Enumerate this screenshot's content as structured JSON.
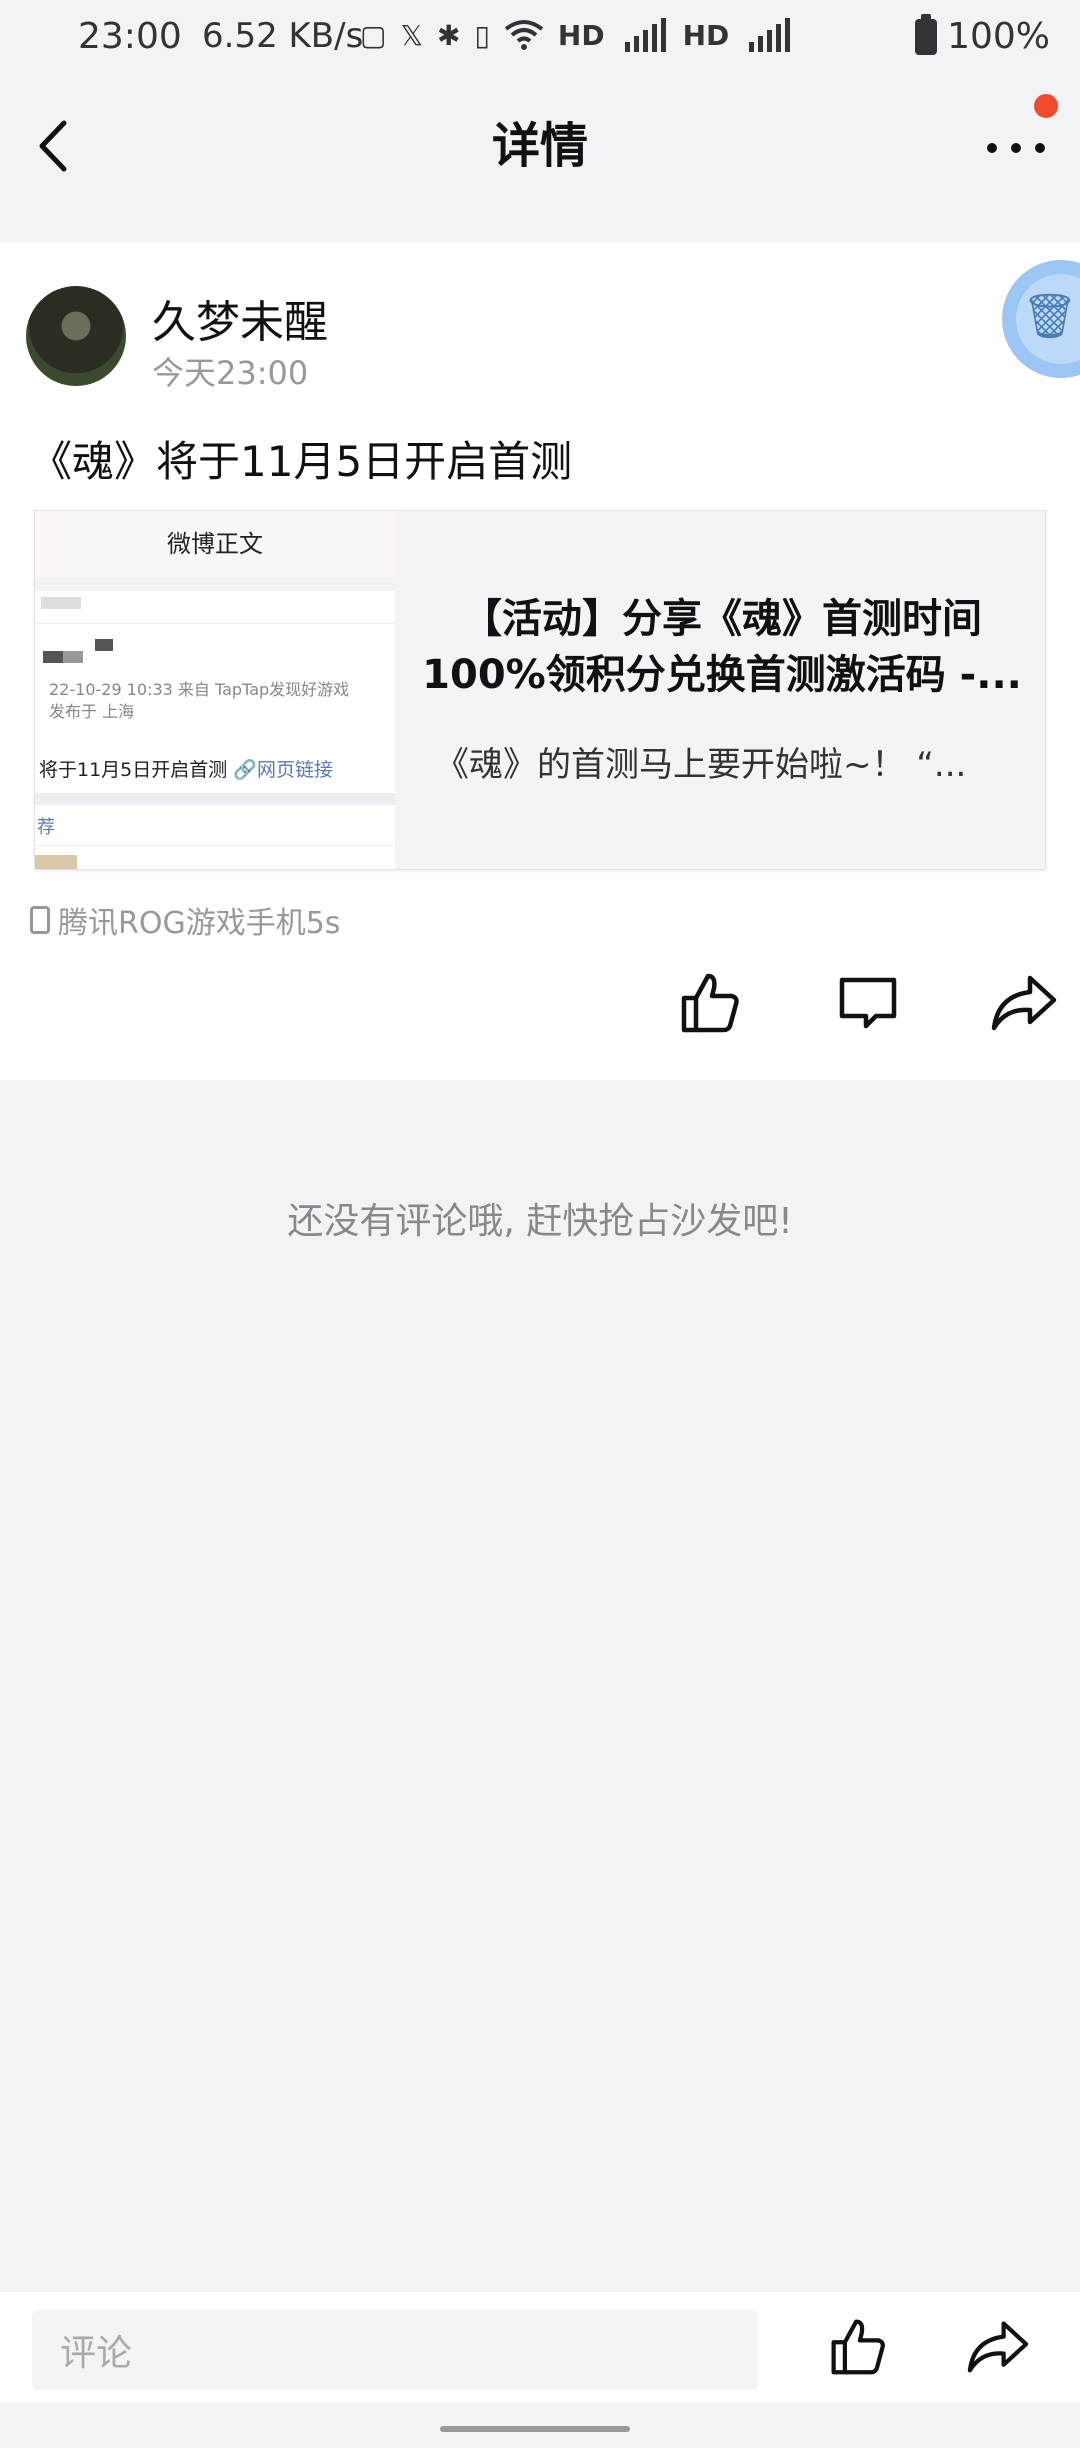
{
  "status_bar": {
    "time": "23:00",
    "net_speed": "6.52 KB/s",
    "battery": "100%",
    "icons": [
      "120hz-icon",
      "x-icon",
      "bluetooth-icon",
      "vibrate-icon",
      "wifi-icon",
      "hd-icon",
      "signal-4g-icon",
      "hd-icon",
      "signal-4g-icon"
    ]
  },
  "header": {
    "title": "详情",
    "back_icon": "chevron-left-icon",
    "more_icon": "more-dots-icon",
    "badge_color": "#f04a2f"
  },
  "post": {
    "username": "久梦未醒",
    "time": "今天23:00",
    "text": "《魂》将于11月5日开启首测",
    "link_card": {
      "title": "【活动】分享《魂》首测时间100%领积分兑换首测激活码 -...",
      "desc": "《魂》的首测马上要开始啦~！  “...",
      "thumbnail": {
        "header": "微博正文",
        "meta_line1": "22-10-29 10:33   来自 TapTap发现好游戏",
        "meta_line2": "发布于 上海",
        "post_text": "将于11月5日开启首测",
        "link_text": "网页链接",
        "section": "荐"
      }
    },
    "device": "腾讯ROG游戏手机5s",
    "actions": [
      "like-icon",
      "comment-icon",
      "share-icon"
    ]
  },
  "comments": {
    "empty_text": "还没有评论哦, 赶快抢占沙发吧!"
  },
  "bottom_bar": {
    "comment_placeholder": "评论"
  },
  "colors": {
    "accent_blue": "#9cc6f3",
    "background": "#f2f3f7"
  }
}
